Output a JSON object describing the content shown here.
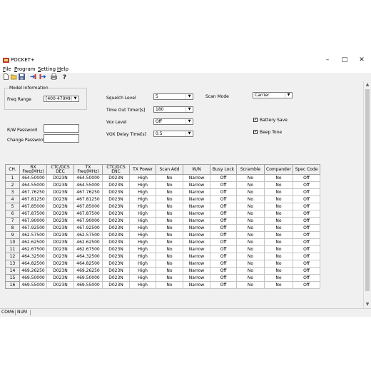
{
  "window": {
    "title": "POCKET+"
  },
  "menu": [
    {
      "ul": "F",
      "rest": "ile"
    },
    {
      "ul": "P",
      "rest": "rogram"
    },
    {
      "ul": "S",
      "rest": "etting"
    },
    {
      "ul": "H",
      "rest": "elp"
    }
  ],
  "toolbar": {
    "icons": [
      "new-file-icon",
      "open-folder-icon",
      "save-icon",
      "read-from-radio-icon",
      "write-to-radio-icon",
      "print-icon",
      "about-help-icon"
    ]
  },
  "model_info": {
    "legend": "Model Information",
    "freq_range_label": "Freq Range",
    "freq_range_value": "[400-470MHz]"
  },
  "settings": {
    "squelch_level_label": "Squelch Level",
    "squelch_level_value": "5",
    "time_out_timer_label": "Time Out Timer[s]",
    "time_out_timer_value": "180",
    "vox_level_label": "Vox Level",
    "vox_level_value": "Off",
    "vox_delay_label": "VOX Delay Time[s]",
    "vox_delay_value": "0.5",
    "scan_mode_label": "Scan Mode",
    "scan_mode_value": "Carrier",
    "battery_save_label": "Battery Save",
    "battery_save_checked": true,
    "beep_tone_label": "Beep Tone",
    "beep_tone_checked": true
  },
  "passwords": {
    "rw_label": "R/W Password",
    "change_label": "Change Password"
  },
  "table": {
    "headers": [
      "CH.",
      "RX Freq(MHz)",
      "CTC/DCS DEC",
      "TX Freq(MHz)",
      "CTC/DCS ENC",
      "TX Power",
      "Scan Add",
      "W/N",
      "Busy Lock",
      "Scramble",
      "Compander",
      "Spec Code"
    ],
    "rows": [
      [
        "1",
        "464.50000",
        "D023N",
        "464.50000",
        "D023N",
        "High",
        "No",
        "Narrow",
        "Off",
        "No",
        "No",
        "Off"
      ],
      [
        "2",
        "464.55000",
        "D023N",
        "464.55000",
        "D023N",
        "High",
        "No",
        "Narrow",
        "Off",
        "No",
        "No",
        "Off"
      ],
      [
        "3",
        "467.76250",
        "D023N",
        "467.76250",
        "D023N",
        "High",
        "No",
        "Narrow",
        "Off",
        "No",
        "No",
        "Off"
      ],
      [
        "4",
        "467.81250",
        "D023N",
        "467.81250",
        "D023N",
        "High",
        "No",
        "Narrow",
        "Off",
        "No",
        "No",
        "Off"
      ],
      [
        "5",
        "467.85000",
        "D023N",
        "467.85000",
        "D023N",
        "High",
        "No",
        "Narrow",
        "Off",
        "No",
        "No",
        "Off"
      ],
      [
        "6",
        "467.87500",
        "D023N",
        "467.87500",
        "D023N",
        "High",
        "No",
        "Narrow",
        "Off",
        "No",
        "No",
        "Off"
      ],
      [
        "7",
        "467.90000",
        "D023N",
        "467.90000",
        "D023N",
        "High",
        "No",
        "Narrow",
        "Off",
        "No",
        "No",
        "Off"
      ],
      [
        "8",
        "467.92500",
        "D023N",
        "467.92500",
        "D023N",
        "High",
        "No",
        "Narrow",
        "Off",
        "No",
        "No",
        "Off"
      ],
      [
        "9",
        "462.57500",
        "D023N",
        "462.57500",
        "D023N",
        "High",
        "No",
        "Narrow",
        "Off",
        "No",
        "No",
        "Off"
      ],
      [
        "10",
        "462.62500",
        "D023N",
        "462.62500",
        "D023N",
        "High",
        "No",
        "Narrow",
        "Off",
        "No",
        "No",
        "Off"
      ],
      [
        "11",
        "462.67500",
        "D023N",
        "462.67500",
        "D023N",
        "High",
        "No",
        "Narrow",
        "Off",
        "No",
        "No",
        "Off"
      ],
      [
        "12",
        "464.32500",
        "D023N",
        "464.32500",
        "D023N",
        "High",
        "No",
        "Narrow",
        "Off",
        "No",
        "No",
        "Off"
      ],
      [
        "13",
        "464.82500",
        "D023N",
        "464.82500",
        "D023N",
        "High",
        "No",
        "Narrow",
        "Off",
        "No",
        "No",
        "Off"
      ],
      [
        "14",
        "469.26250",
        "D023N",
        "469.26250",
        "D023N",
        "High",
        "No",
        "Narrow",
        "Off",
        "No",
        "No",
        "Off"
      ],
      [
        "15",
        "469.50000",
        "D023N",
        "469.50000",
        "D023N",
        "High",
        "No",
        "Narrow",
        "Off",
        "No",
        "No",
        "Off"
      ],
      [
        "16",
        "469.55000",
        "D023N",
        "469.55000",
        "D023N",
        "High",
        "No",
        "Narrow",
        "Off",
        "No",
        "No",
        "Off"
      ]
    ]
  },
  "status": {
    "port": "COM6",
    "numlock": "NUM"
  }
}
